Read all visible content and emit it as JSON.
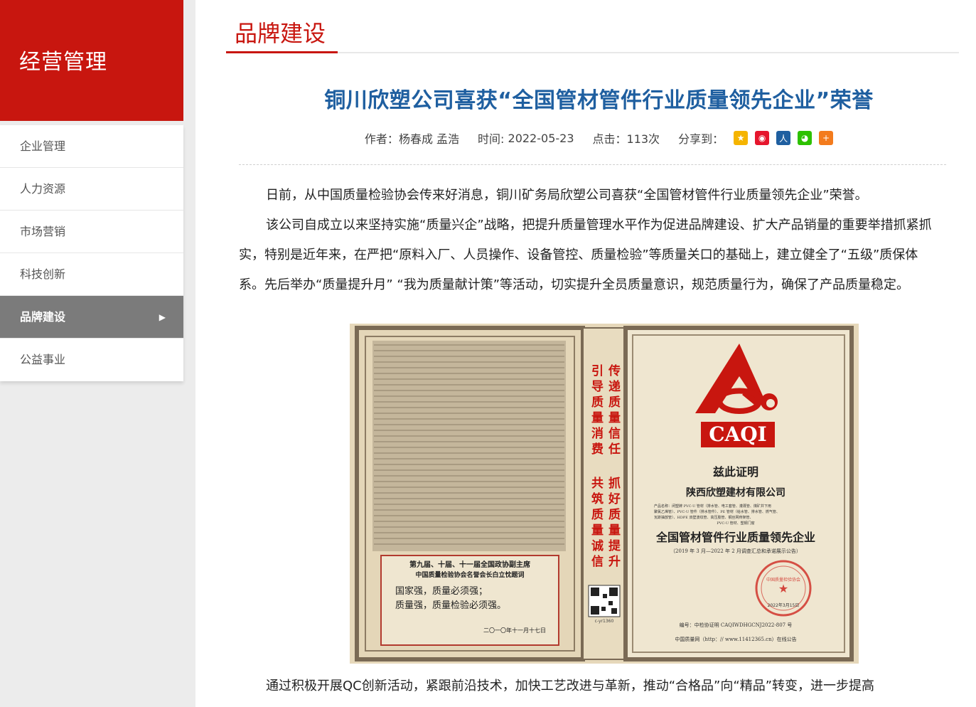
{
  "sidebar": {
    "title": "经营管理",
    "items": [
      {
        "label": "企业管理",
        "active": false
      },
      {
        "label": "人力资源",
        "active": false
      },
      {
        "label": "市场营销",
        "active": false
      },
      {
        "label": "科技创新",
        "active": false
      },
      {
        "label": "品牌建设",
        "active": true
      },
      {
        "label": "公益事业",
        "active": false
      }
    ],
    "active_arrow": "▶"
  },
  "section": {
    "title": "品牌建设"
  },
  "article": {
    "title": "铜川欣塑公司喜获“全国管材管件行业质量领先企业”荣誉",
    "author_label": "作者：",
    "author": "杨春成 孟浩",
    "time_label": "时间: ",
    "time": "2022-05-23",
    "clicks_label": "点击：",
    "clicks": "113次",
    "share_label": "分享到：",
    "share_icons": [
      {
        "name": "qzone-icon",
        "glyph": "★",
        "color": "#f5b400"
      },
      {
        "name": "weibo-icon",
        "glyph": "◉",
        "color": "#e6162d"
      },
      {
        "name": "renren-icon",
        "glyph": "人",
        "color": "#1f5fa0"
      },
      {
        "name": "wechat-icon",
        "glyph": "◕",
        "color": "#2dc100"
      },
      {
        "name": "more-share-icon",
        "glyph": "+",
        "color": "#f37b1d"
      }
    ],
    "paragraphs": [
      "日前，从中国质量检验协会传来好消息，铜川矿务局欣塑公司喜获“全国管材管件行业质量领先企业”荣誉。",
      "该公司自成立以来坚持实施“质量兴企”战略，把提升质量管理水平作为促进品牌建设、扩大产品销量的重要举措抓紧抓实，特别是近年来，在严把“原料入厂、人员操作、设备管控、质量检验”等质量关口的基础上，建立健全了“五级”质保体系。先后举办“质量提升月” “我为质量献计策”等活动，切实提升全员质量意识，规范质量行为，确保了产品质量稳定。"
    ],
    "last_paragraph": "通过积极开展QC创新活动，紧跟前沿技术，加快工艺改进与革新，推动“合格品”向“精品”转变，进一步提高"
  },
  "certificate": {
    "logo_text": "CAQI",
    "proof": "兹此证明",
    "company": "陕西欣塑建材有限公司",
    "product_lines": [
      "产品名称：闭塑牌 PVC-U 管材（排水管、电工套管、灌溉管、煤矿井下用",
      "聚氯乙烯管）、PVC-U 管件（排水管件）、PE 管材（给水管、排水管、燃气管、",
      "瓦斯抽放管）、HDPE 双壁波纹管、高压胶管、钢丝网骨架管、",
      "PVC-U 管材、塑钢门窗"
    ],
    "honor": "全国管材管件行业质量领先企业",
    "period": "（2019 年 3 月—2022 年 2 月调查汇总和承诺展示公告）",
    "number": "编号：中检协证明 CAQIWDHGCNJ2022-807 号",
    "site": "中国质量网（http：// www.11412365.cn）在线公告",
    "slogan_left": [
      "引导质量消费",
      "共筑质量诚信"
    ],
    "slogan_right": [
      "传递质量信任",
      "抓好质量提升"
    ],
    "quote_header": [
      "第九届、十届、十一届全国政协副主席",
      "中国质量检验协会名誉会长白立忱题词"
    ],
    "quote": [
      "国家强，质量必须强；",
      "质量强，质量检验必须强。"
    ],
    "quote_date": "二〇一〇年十一月十七日",
    "seal_text": "中国质量检验协会",
    "seal_date": "2022年3月15日",
    "qr_code_label": "c-yr1360"
  }
}
